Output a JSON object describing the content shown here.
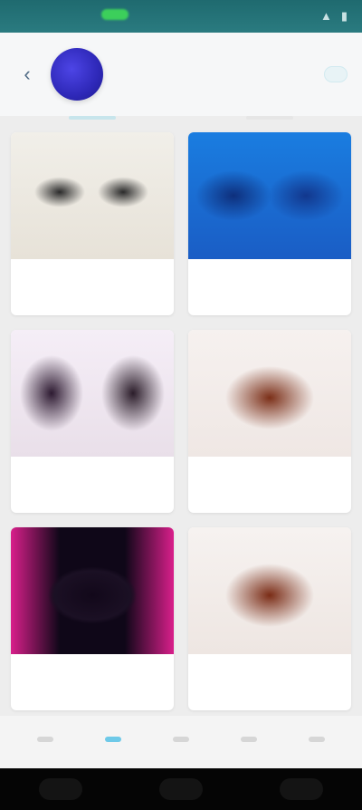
{
  "status_bar": {
    "time": "",
    "icons": []
  },
  "header": {
    "title": "",
    "subtitle": "",
    "follow_label": "",
    "avatar_text": ""
  },
  "tabs": {
    "left": "",
    "right": ""
  },
  "products": [
    {
      "caption": "",
      "price": ""
    },
    {
      "caption": "",
      "price": ""
    },
    {
      "caption": "",
      "price": ""
    },
    {
      "caption": "",
      "price": ""
    },
    {
      "caption": "",
      "price": ""
    },
    {
      "caption": "",
      "price": ""
    }
  ],
  "bottom_nav": [
    {
      "label": "",
      "active": false
    },
    {
      "label": "",
      "active": true
    },
    {
      "label": "",
      "active": false
    },
    {
      "label": "",
      "active": false
    },
    {
      "label": "",
      "active": false
    }
  ],
  "colors": {
    "accent": "#6ec9e8",
    "status_bar": "#2a7b80",
    "price": "#e04c4c",
    "avatar": "#2e28b8"
  },
  "icons": {
    "back": "back-arrow-icon",
    "wifi": "wifi-icon",
    "battery": "battery-icon"
  }
}
